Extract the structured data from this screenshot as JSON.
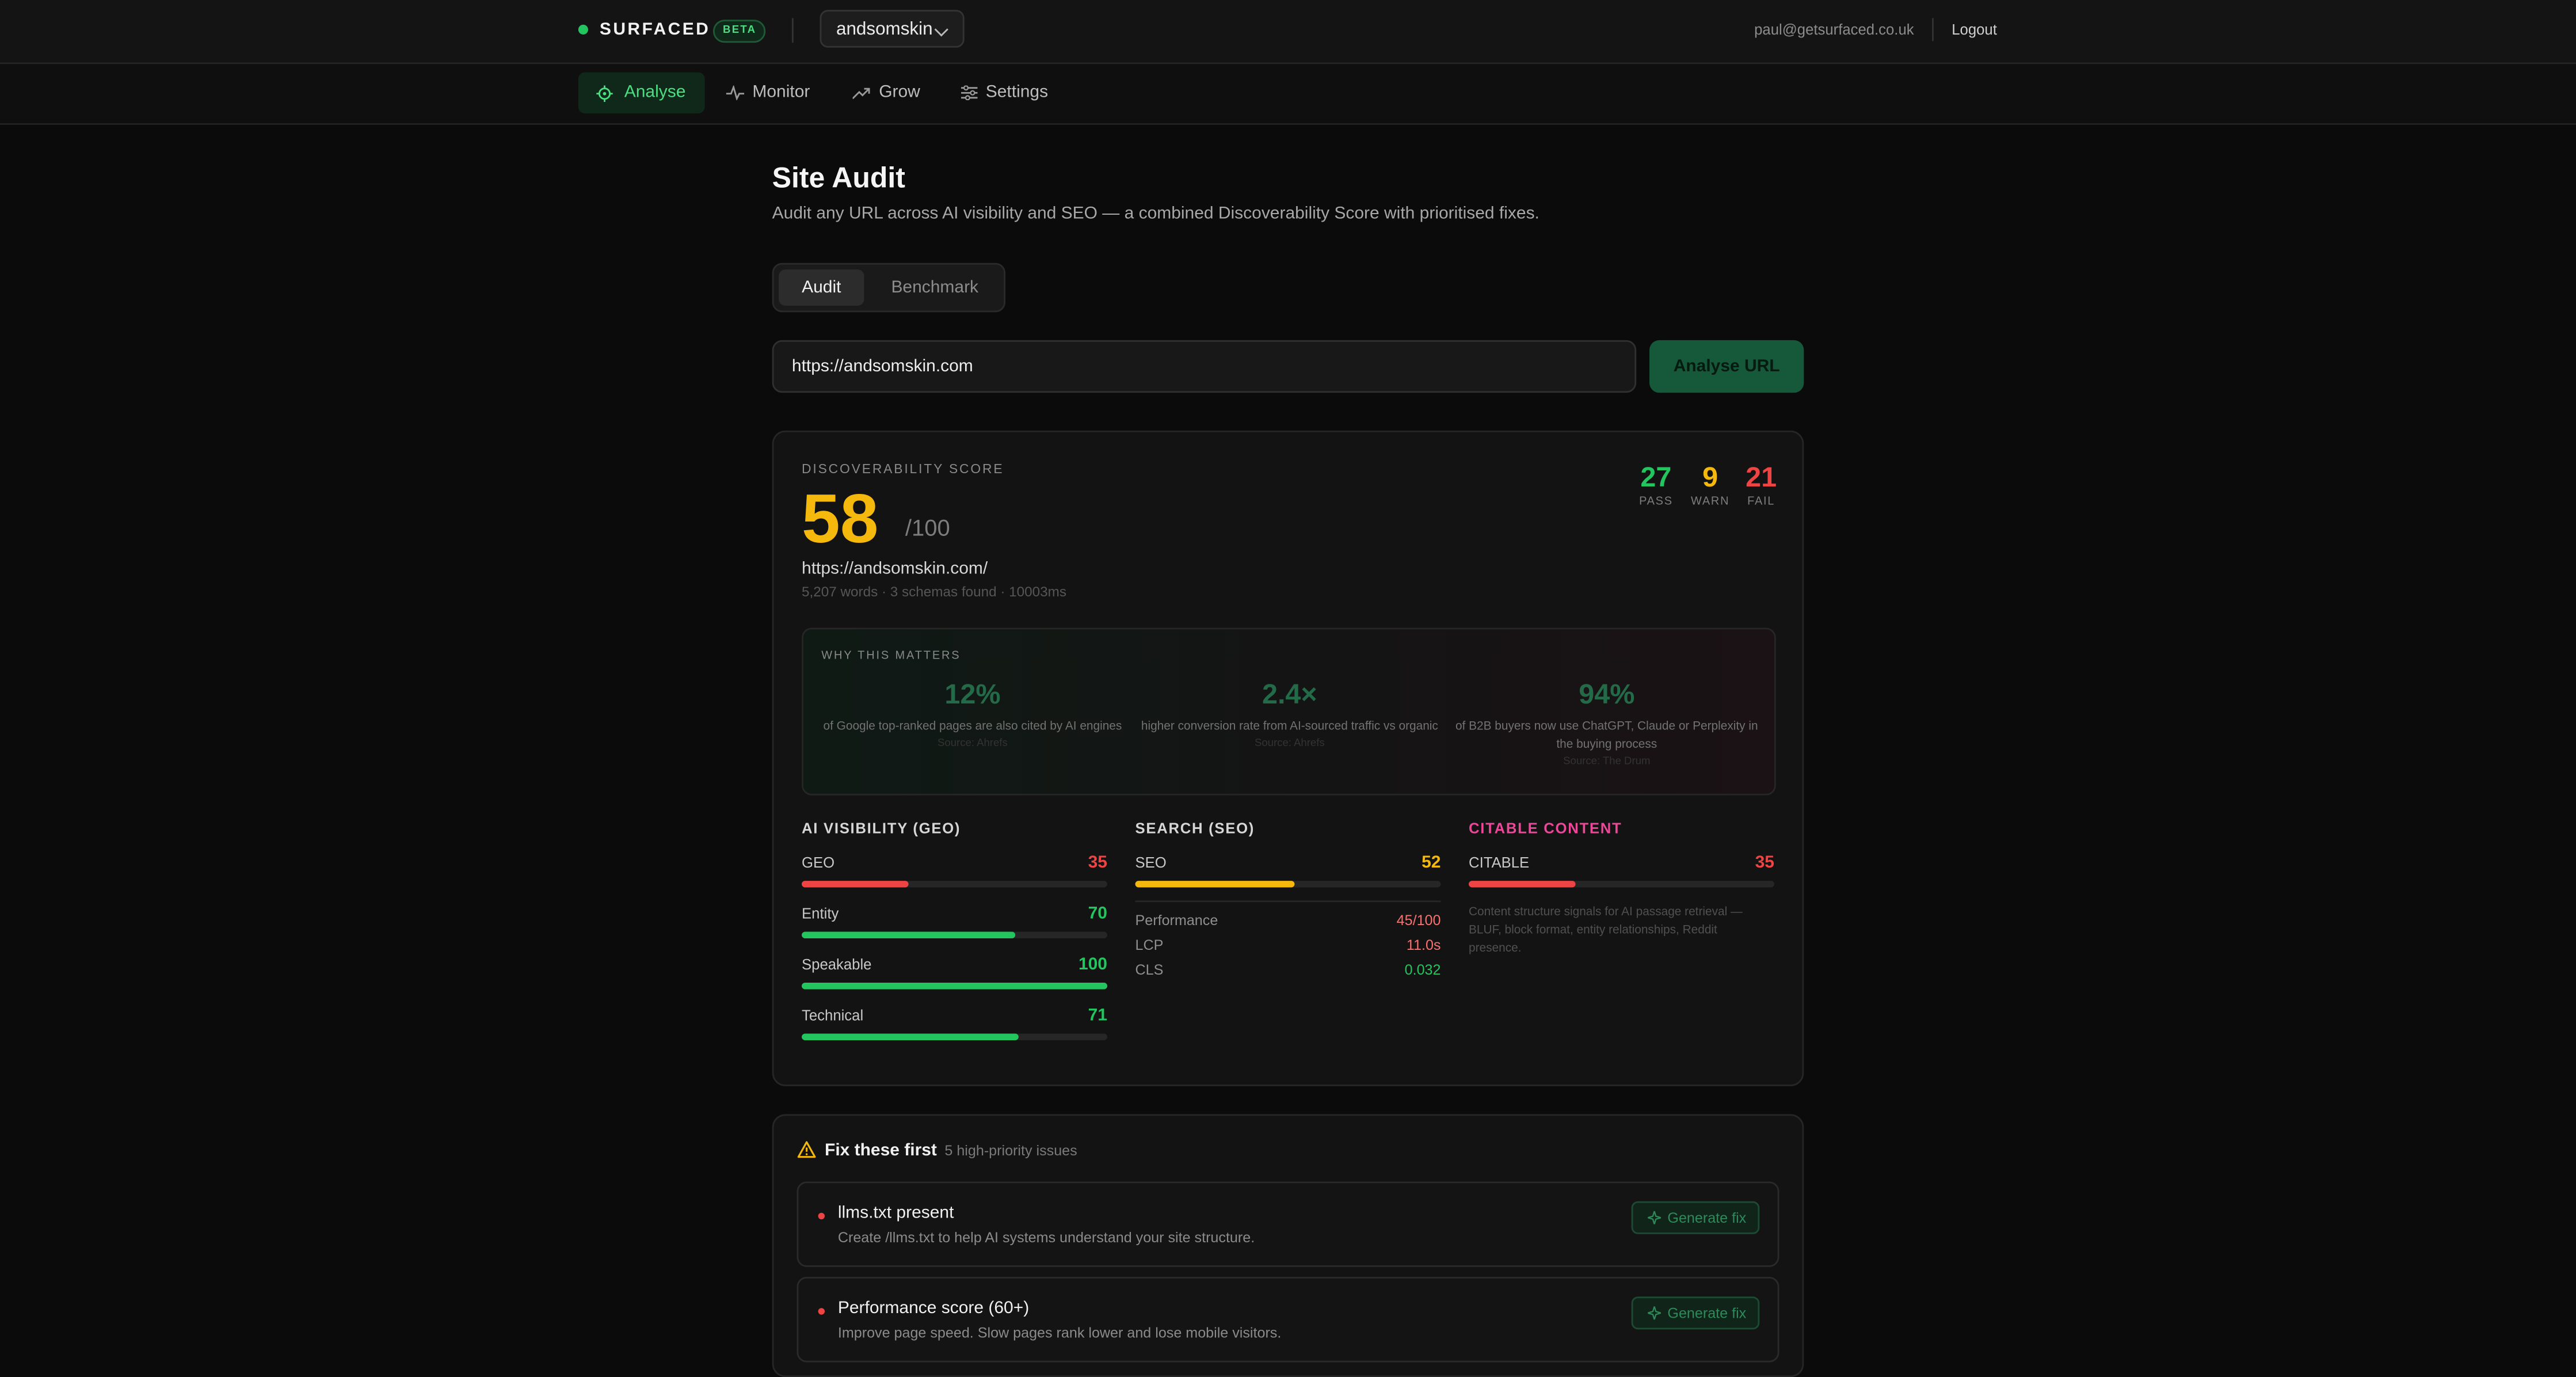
{
  "topbar": {
    "brand": "SURFACED",
    "badge": "BETA",
    "site": "andsomskin",
    "email": "paul@getsurfaced.co.uk",
    "logout": "Logout"
  },
  "nav": {
    "items": [
      {
        "label": "Analyse",
        "icon": "target-icon"
      },
      {
        "label": "Monitor",
        "icon": "pulse-icon"
      },
      {
        "label": "Grow",
        "icon": "trending-up-icon"
      },
      {
        "label": "Settings",
        "icon": "sliders-icon"
      }
    ]
  },
  "main": {
    "title": "Site Audit",
    "subtitle": "Audit any URL across AI visibility and SEO — a combined Discoverability Score with prioritised fixes.",
    "tabs": [
      "Audit",
      "Benchmark"
    ],
    "url_value": "https://andsomskin.com",
    "analyse_button": "Analyse URL"
  },
  "score": {
    "caption": "DISCOVERABILITY SCORE",
    "value": "58",
    "out_of": "/100",
    "url": "https://andsomskin.com/",
    "meta": "5,207 words · 3 schemas found · 10003ms",
    "pass": {
      "n": "27",
      "label": "PASS",
      "color": "#22c55e"
    },
    "warn": {
      "n": "9",
      "label": "WARN",
      "color": "#f5b80c"
    },
    "fail": {
      "n": "21",
      "label": "FAIL",
      "color": "#ef4444"
    }
  },
  "why": {
    "caption": "WHY THIS MATTERS",
    "stats": [
      {
        "value": "12%",
        "desc": "of Google top-ranked pages are also cited by AI engines",
        "source": "Source: Ahrefs"
      },
      {
        "value": "2.4×",
        "desc": "higher conversion rate from AI-sourced traffic vs organic",
        "source": "Source: Ahrefs"
      },
      {
        "value": "94%",
        "desc": "of B2B buyers now use ChatGPT, Claude or Perplexity in the buying process",
        "source": "Source: The Drum"
      }
    ]
  },
  "geo": {
    "title": "AI VISIBILITY (GEO)",
    "metrics": [
      {
        "label": "GEO",
        "value": 35,
        "color": "#ef4444"
      },
      {
        "label": "Entity",
        "value": 70,
        "color": "#22c55e"
      },
      {
        "label": "Speakable",
        "value": 100,
        "color": "#22c55e"
      },
      {
        "label": "Technical",
        "value": 71,
        "color": "#22c55e"
      }
    ]
  },
  "seo": {
    "title": "SEARCH (SEO)",
    "metric": {
      "label": "SEO",
      "value": 52,
      "color": "#f5b80c"
    },
    "details": [
      {
        "label": "Performance",
        "value": "45/100",
        "color": "#f87171"
      },
      {
        "label": "LCP",
        "value": "11.0s",
        "color": "#f87171"
      },
      {
        "label": "CLS",
        "value": "0.032",
        "color": "#22c55e"
      }
    ]
  },
  "citable": {
    "title": "CITABLE CONTENT",
    "metric": {
      "label": "CITABLE",
      "value": 35,
      "color": "#ef4444"
    },
    "desc": "Content structure signals for AI passage retrieval — BLUF, block format, entity relationships, Reddit presence."
  },
  "fixes": {
    "title": "Fix these first",
    "count": "5 high-priority issues",
    "button": "Generate fix",
    "items": [
      {
        "title": "llms.txt present",
        "desc": "Create /llms.txt to help AI systems understand your site structure."
      },
      {
        "title": "Performance score (60+)",
        "desc": "Improve page speed. Slow pages rank lower and lose mobile visitors."
      }
    ]
  }
}
